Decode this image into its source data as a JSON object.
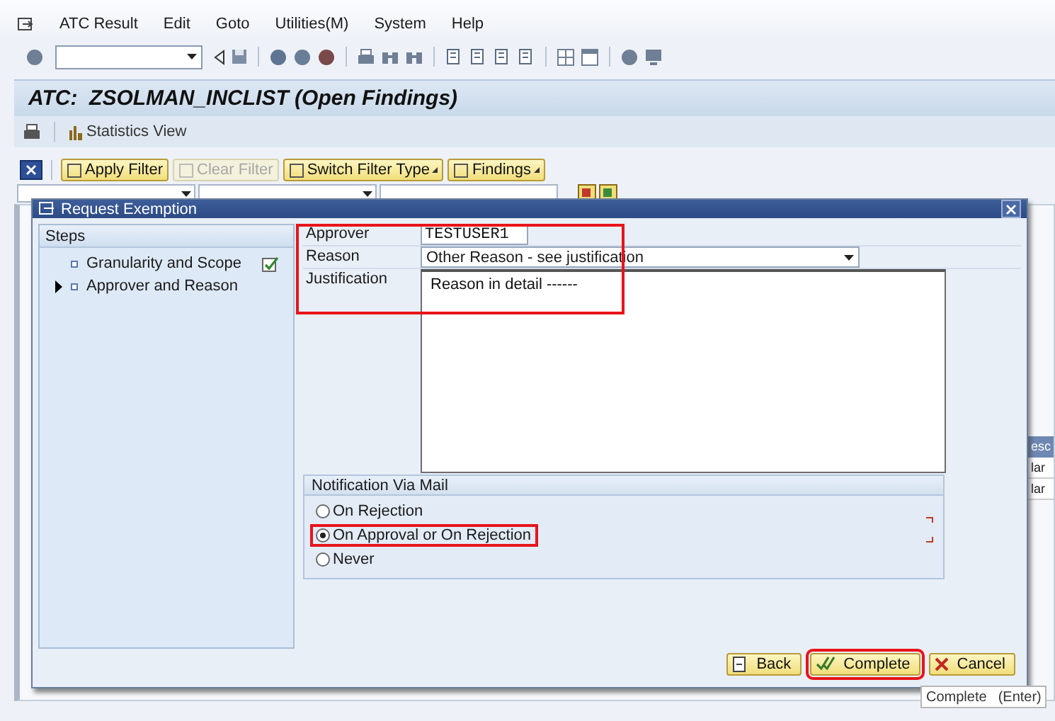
{
  "menu_bar": {
    "items": [
      "ATC Result",
      "Edit",
      "Goto",
      "Utilities(M)",
      "System",
      "Help"
    ]
  },
  "title": "ATC:  ZSOLMAN_INCLIST (Open Findings)",
  "app_toolbar": {
    "items": [
      "Statistics View"
    ]
  },
  "filter_toolbar": {
    "buttons": [
      {
        "label": "Apply Filter",
        "disabled": false,
        "menu": false
      },
      {
        "label": "Clear Filter",
        "disabled": true,
        "menu": false
      },
      {
        "label": "Switch Filter Type",
        "disabled": false,
        "menu": true
      },
      {
        "label": "Findings",
        "disabled": false,
        "menu": true
      }
    ]
  },
  "background_table": {
    "header": "esc",
    "rows": [
      "lar",
      "lar"
    ]
  },
  "dialog": {
    "title": "Request Exemption",
    "steps": {
      "heading": "Steps",
      "items": [
        {
          "label": "Granularity and Scope",
          "completed": true,
          "current": false
        },
        {
          "label": "Approver and Reason",
          "completed": false,
          "current": true
        }
      ]
    },
    "form": {
      "highlighted": true,
      "approver": {
        "label": "Approver",
        "value": "TESTUSER1"
      },
      "reason": {
        "label": "Reason",
        "value": "Other Reason - see justification"
      },
      "justification": {
        "label": "Justification",
        "value": "Reason in detail ------"
      }
    },
    "notification": {
      "title": "Notification Via Mail",
      "options": [
        {
          "label": "On Rejection",
          "selected": false,
          "highlighted": false
        },
        {
          "label": "On Approval or On Rejection",
          "selected": true,
          "highlighted": true
        },
        {
          "label": "Never",
          "selected": false,
          "highlighted": false
        }
      ]
    },
    "buttons": [
      {
        "label": "Back",
        "kind": "back",
        "highlighted": false
      },
      {
        "label": "Complete",
        "kind": "complete",
        "highlighted": true
      },
      {
        "label": "Cancel",
        "kind": "cancel",
        "highlighted": false
      }
    ]
  },
  "tooltip": {
    "text": "Complete",
    "shortcut": "(Enter)"
  }
}
